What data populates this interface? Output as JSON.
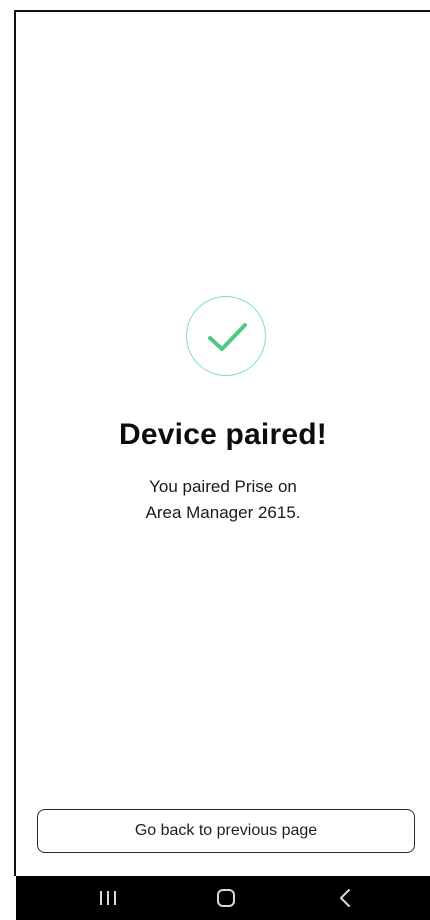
{
  "success": {
    "icon": "checkmark-circle-icon",
    "title": "Device paired!",
    "message_line1": "You paired Prise on",
    "message_line2": "Area Manager 2615."
  },
  "actions": {
    "back_label": "Go back to previous page"
  },
  "system_nav": {
    "recent_icon": "recent-apps-icon",
    "home_icon": "home-icon",
    "back_icon": "back-arrow-icon"
  },
  "colors": {
    "accent_green": "#4cc987",
    "circle_border": "#7fe3a9",
    "text": "#0d0d0d",
    "nav_bar": "#000000"
  }
}
